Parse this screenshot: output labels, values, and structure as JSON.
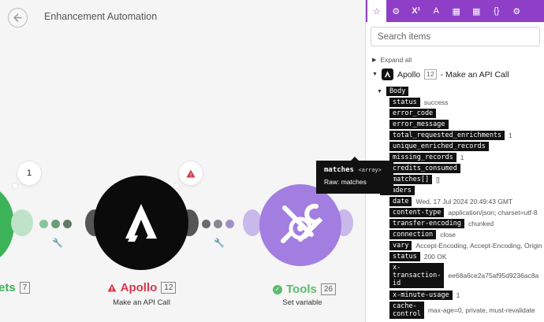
{
  "header": {
    "title": "Enhancement Automation"
  },
  "nodes": {
    "left": {
      "name_fragment": "ets",
      "badge": "7",
      "bubble": "1"
    },
    "apollo": {
      "name": "Apollo",
      "badge": "12",
      "subtitle": "Make an API Call",
      "warning": "!"
    },
    "tools": {
      "name": "Tools",
      "badge": "26",
      "subtitle": "Set variable",
      "check": "✓"
    }
  },
  "tooltip": {
    "key": "matches",
    "type": "<array>",
    "raw": "Raw: matches"
  },
  "panel": {
    "tabs": [
      "☆",
      "⚙",
      "X¹",
      "A",
      "▦",
      "▦",
      "{}",
      "⚙"
    ],
    "search_placeholder": "Search items",
    "expand_all": "Expand all",
    "module": {
      "name": "Apollo",
      "number": "12",
      "action": "- Make an API Call"
    },
    "tree": {
      "body": "Body",
      "body_items": [
        {
          "key": "status",
          "value": "success"
        },
        {
          "key": "error_code",
          "value": ""
        },
        {
          "key": "error_message",
          "value": ""
        },
        {
          "key": "total_requested_enrichments",
          "value": "1"
        },
        {
          "key": "unique_enriched_records",
          "value": ""
        },
        {
          "key": "missing_records",
          "value": "1"
        },
        {
          "key": "credits_consumed",
          "value": ""
        },
        {
          "key": "matches[]",
          "value": "[]"
        }
      ],
      "headers": "Headers",
      "header_items": [
        {
          "key": "date",
          "value": "Wed, 17 Jul 2024 20:49:43 GMT"
        },
        {
          "key": "content-type",
          "value": "application/json; charset=utf-8"
        },
        {
          "key": "transfer-encoding",
          "value": "chunked"
        },
        {
          "key": "connection",
          "value": "close"
        },
        {
          "key": "vary",
          "value": "Accept-Encoding, Accept-Encoding, Origin"
        },
        {
          "key": "status",
          "value": "200 OK"
        },
        {
          "key": "x-\ntransaction-\nid",
          "value": "ee68a6ce2a75af95d9236ac8a"
        },
        {
          "key": "x-minute-usage",
          "value": "1"
        },
        {
          "key": "cache-\ncontrol",
          "value": "max-age=0, private, must-revalidate"
        }
      ]
    }
  }
}
